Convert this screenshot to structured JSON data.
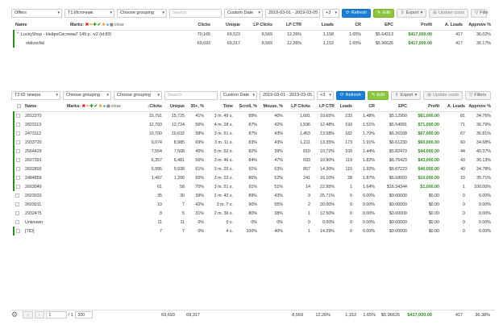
{
  "top": {
    "toolbar": {
      "source": "Offers",
      "source2": "T1:Источник",
      "grouping": "Choose grouping",
      "search_placeholder": "Search",
      "date_mode": "Custom Date",
      "date_range": "2019-03-01 - 2019-03-05",
      "tz": "+3",
      "refresh": "Refresh",
      "edit": "Edit",
      "export": "Export",
      "update_costs": "Update costs",
      "filters": "Filte"
    },
    "headers": [
      "Name",
      "Marks:",
      "Clicks",
      "Unique",
      "LP Clicks",
      "LP CTR",
      "Leads",
      "CR",
      "EPC",
      "Profit",
      "A. Leads",
      "Approve %"
    ],
    "rows": [
      {
        "name": "LuckyShop - НейроСистема7 149 р. -v2 (id:83)",
        "marks": true,
        "clicks": "70,165",
        "unique": "69,523",
        "lpclicks": "8,569",
        "lpctr": "12.26%",
        "leads": "1,158",
        "cr": "1.65%",
        "epc": "$5.64313",
        "profit": "$417,000.00",
        "aleads": "417",
        "approve": "36.02%"
      },
      {
        "name": "oblivochki",
        "marks": false,
        "clicks": "69,693",
        "unique": "69,317",
        "lpclicks": "8,569",
        "lpctr": "12.26%",
        "leads": "1,153",
        "cr": "1.65%",
        "epc": "$5.96626",
        "profit": "$417,000.00",
        "aleads": "417",
        "approve": "36.17%"
      }
    ],
    "clear": "clear"
  },
  "bottom": {
    "toolbar": {
      "source": "T2:ID тизера",
      "grouping1": "Choose grouping",
      "grouping2": "Choose grouping",
      "search_placeholder": "Search",
      "date_mode": "Custom Date",
      "date_range": "2019-03-01 - 2019-03-05",
      "tz": "+3",
      "refresh": "Refresh",
      "edit": "Edit",
      "export": "Export",
      "update_costs": "Update costs",
      "filters": "Filters"
    },
    "headers": [
      "Name",
      "Marks:",
      "Clicks",
      "Unique",
      "30+, %",
      "Time",
      "Scroll, %",
      "Mouse, %",
      "LP Clicks",
      "LP CTR",
      "Leads",
      "CR",
      "EPC",
      "Profit",
      "A. Leads",
      "Approve %"
    ],
    "clear": "clear",
    "rows": [
      {
        "name": "2812370",
        "clicks": "15,791",
        "unique": "15,725",
        "p30": "41%",
        "time": "3 m. 49 s.",
        "scroll": "89%",
        "mouse": "40%",
        "lpclicks": "1,681",
        "lpctr": "10.65%",
        "leads": "233",
        "cr": "1.48%",
        "epc": "$5.12950",
        "profit": "$81,000.00",
        "aleads": "81",
        "approve": "34.76%",
        "bar": true
      },
      {
        "name": "2823113",
        "clicks": "12,793",
        "unique": "12,724",
        "p30": "56%",
        "time": "4 m. 28 s.",
        "scroll": "87%",
        "mouse": "42%",
        "lpclicks": "1,596",
        "lpctr": "12.48%",
        "leads": "193",
        "cr": "1.51%",
        "epc": "$5.54991",
        "profit": "$71,000.00",
        "aleads": "71",
        "approve": "36.79%",
        "bar": true
      },
      {
        "name": "2473112",
        "clicks": "10,700",
        "unique": "10,632",
        "p30": "58%",
        "time": "3 m. 51 s.",
        "scroll": "87%",
        "mouse": "43%",
        "lpclicks": "1,453",
        "lpctr": "13.58%",
        "leads": "182",
        "cr": "1.70%",
        "epc": "$6.26168",
        "profit": "$67,000.00",
        "aleads": "67",
        "approve": "36.81%",
        "bar": true
      },
      {
        "name": "2933720",
        "clicks": "9,074",
        "unique": "8,985",
        "p30": "69%",
        "time": "3 m. 11 s.",
        "scroll": "83%",
        "mouse": "43%",
        "lpclicks": "1,211",
        "lpctr": "13.35%",
        "leads": "173",
        "cr": "1.91%",
        "epc": "$6.61230",
        "profit": "$60,000.00",
        "aleads": "60",
        "approve": "34.68%",
        "bar": true
      },
      {
        "name": "2564429",
        "clicks": "7,554",
        "unique": "7,508",
        "p30": "45%",
        "time": "5 m. 52 s.",
        "scroll": "82%",
        "mouse": "39%",
        "lpclicks": "810",
        "lpctr": "10.72%",
        "leads": "109",
        "cr": "1.44%",
        "epc": "$5.82473",
        "profit": "$44,000.00",
        "aleads": "44",
        "approve": "40.37%",
        "bar": true
      },
      {
        "name": "2607391",
        "clicks": "6,357",
        "unique": "6,481",
        "p30": "56%",
        "time": "3 m. 46 s.",
        "scroll": "84%",
        "mouse": "47%",
        "lpclicks": "693",
        "lpctr": "10.90%",
        "leads": "119",
        "cr": "1.82%",
        "epc": "$6.76423",
        "profit": "$43,000.00",
        "aleads": "43",
        "approve": "36.13%",
        "bar": true
      },
      {
        "name": "2602893",
        "clicks": "5,995",
        "unique": "5,938",
        "p30": "61%",
        "time": "3 m. 25 s.",
        "scroll": "91%",
        "mouse": "53%",
        "lpclicks": "857",
        "lpctr": "14.30%",
        "leads": "115",
        "cr": "1.92%",
        "epc": "$6.67223",
        "profit": "$40,000.00",
        "aleads": "40",
        "approve": "34.78%",
        "bar": true
      },
      {
        "name": "2484859",
        "clicks": "1,497",
        "unique": "1,206",
        "p30": "65%",
        "time": "3 m. 23 s.",
        "scroll": "86%",
        "mouse": "52%",
        "lpclicks": "241",
        "lpctr": "16.10%",
        "leads": "28",
        "cr": "1.87%",
        "epc": "$6.68003",
        "profit": "$10,000.00",
        "aleads": "10",
        "approve": "35.71%",
        "bar": true
      },
      {
        "name": "2603049",
        "clicks": "61",
        "unique": "58",
        "p30": "70%",
        "time": "3 m. 51 s.",
        "scroll": "91%",
        "mouse": "51%",
        "lpclicks": "14",
        "lpctr": "22.95%",
        "leads": "1",
        "cr": "1.64%",
        "epc": "$16.34344",
        "profit": "$1,000.00",
        "aleads": "1",
        "approve": "100.00%",
        "bar": true
      },
      {
        "name": "2603033",
        "clicks": "35",
        "unique": "30",
        "p30": "39%",
        "time": "2 m. 42 s.",
        "scroll": "89%",
        "mouse": "43%",
        "lpclicks": "9",
        "lpctr": "25.71%",
        "leads": "0",
        "cr": "0.00%",
        "epc": "$0.00000",
        "profit": "$0.00",
        "aleads": "0",
        "approve": "0.00%",
        "bar": false
      },
      {
        "name": "2603011",
        "clicks": "10",
        "unique": "7",
        "p30": "42%",
        "time": "3 m. 7 s.",
        "scroll": "90%",
        "mouse": "55%",
        "lpclicks": "2",
        "lpctr": "20.00%",
        "leads": "0",
        "cr": "0.00%",
        "epc": "$0.00000",
        "profit": "$0.00",
        "aleads": "0",
        "approve": "0.00%",
        "bar": false
      },
      {
        "name": "2932475",
        "clicks": "8",
        "unique": "5",
        "p30": "31%",
        "time": "2 m. 36 s.",
        "scroll": "80%",
        "mouse": "38%",
        "lpclicks": "1",
        "lpctr": "12.50%",
        "leads": "0",
        "cr": "0.00%",
        "epc": "$0.00000",
        "profit": "$0.00",
        "aleads": "0",
        "approve": "0.00%",
        "bar": false
      },
      {
        "name": "Unknown",
        "clicks": "11",
        "unique": "11",
        "p30": "0%",
        "time": "0 s.",
        "scroll": "0%",
        "mouse": "0%",
        "lpclicks": "0",
        "lpctr": "0.00%",
        "leads": "0",
        "cr": "0.00%",
        "epc": "$0.00000",
        "profit": "$0.00",
        "aleads": "0",
        "approve": "0.00%",
        "bar": false
      },
      {
        "name": "[TID]",
        "clicks": "7",
        "unique": "7",
        "p30": "0%",
        "time": "4 s.",
        "scroll": "100%",
        "mouse": "40%",
        "lpclicks": "1",
        "lpctr": "14.29%",
        "leads": "0",
        "cr": "0.00%",
        "epc": "$0.00000",
        "profit": "$0.00",
        "aleads": "0",
        "approve": "0.00%",
        "bar": true
      }
    ],
    "footer": {
      "page": "1",
      "of": "/ 1",
      "per_page": "200",
      "clicks": "69,693",
      "unique": "69,317",
      "lpclicks": "8,569",
      "lpctr": "12.26%",
      "leads": "1,153",
      "cr": "1.65%",
      "epc": "$5.96626",
      "profit": "$417,000.00",
      "aleads": "417",
      "approve": "36.38%"
    }
  },
  "colors": {
    "accent_blue": "#1a7fd4",
    "accent_green": "#8cc63f",
    "profit_green": "#2e8b1f"
  }
}
